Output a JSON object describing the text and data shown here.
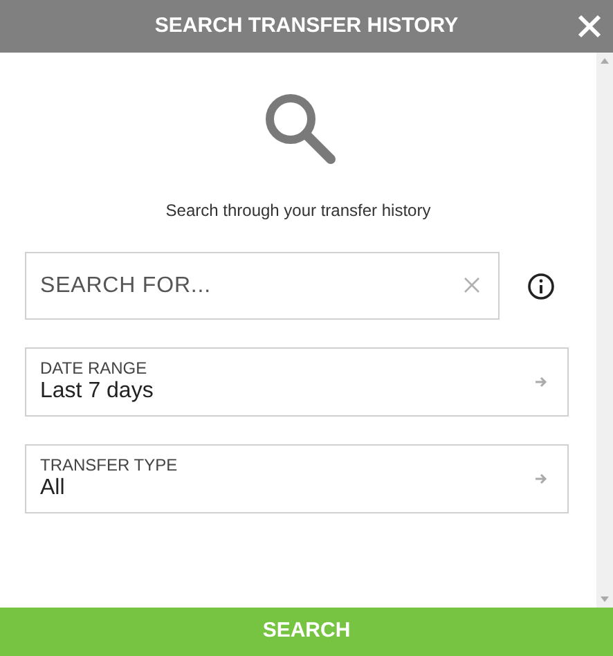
{
  "window": {
    "title": "SEARCH TRANSFER HISTORY"
  },
  "intro": "Search through your transfer history",
  "search": {
    "placeholder": "SEARCH FOR..."
  },
  "selectors": [
    {
      "label": "DATE RANGE",
      "value": "Last 7 days"
    },
    {
      "label": "TRANSFER TYPE",
      "value": "All"
    }
  ],
  "submit": "SEARCH"
}
